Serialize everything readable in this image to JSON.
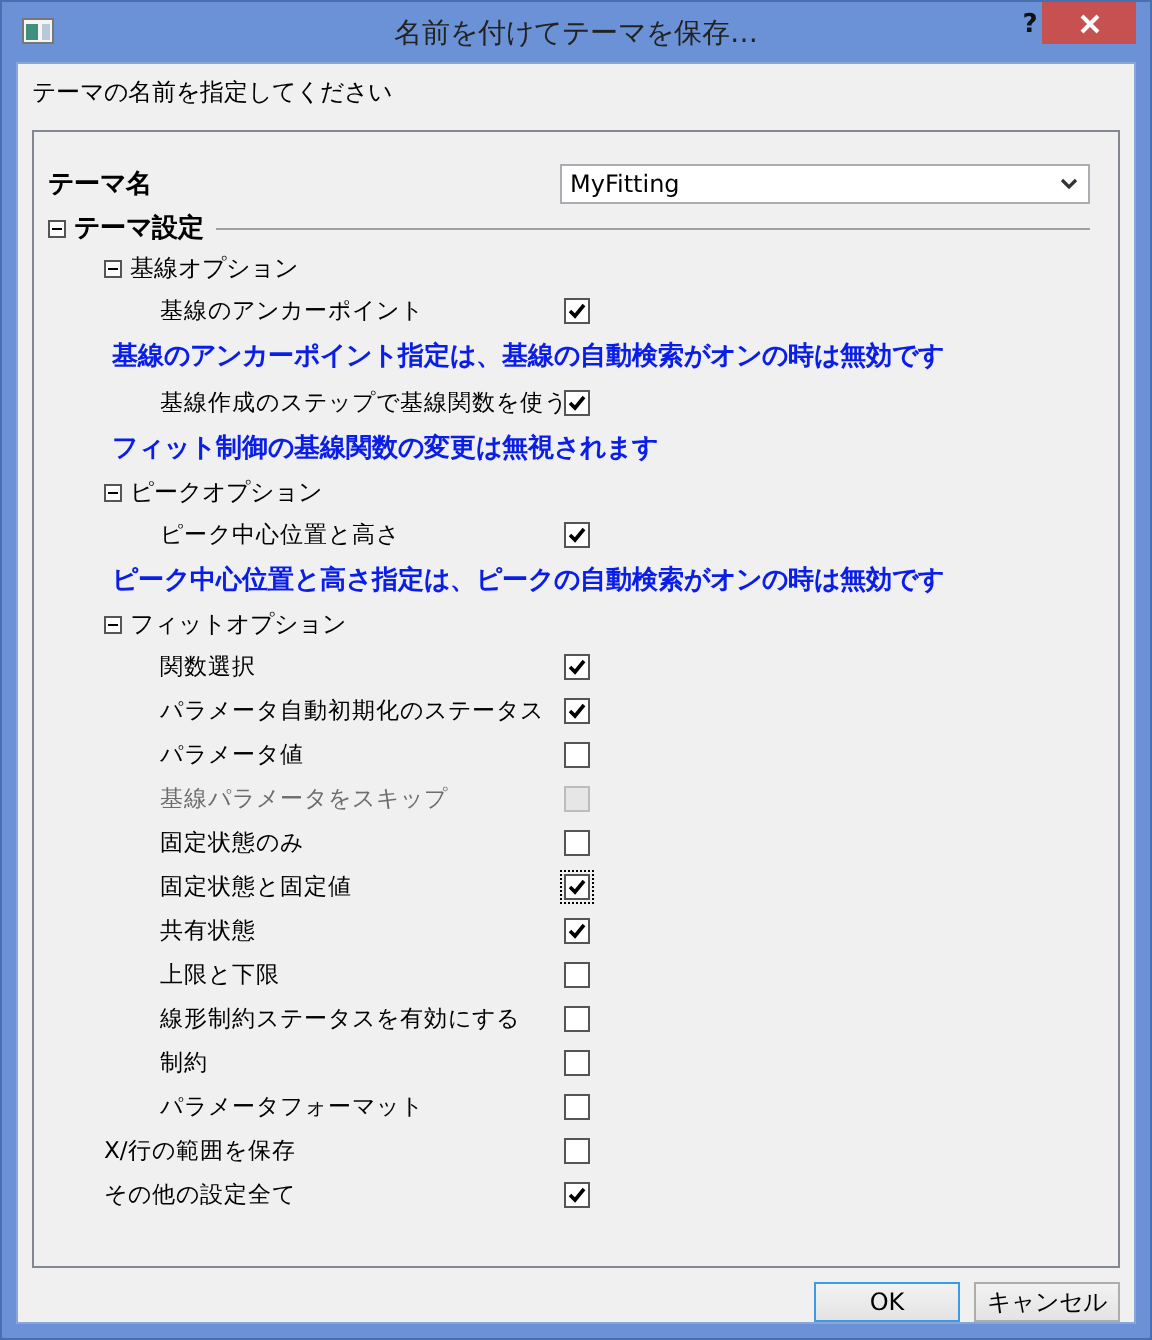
{
  "window": {
    "title": "名前を付けてテーマを保存…",
    "help": "?"
  },
  "prompt": "テーマの名前を指定してください",
  "theme_name": {
    "label": "テーマ名",
    "value": "MyFitting"
  },
  "settings": {
    "label": "テーマ設定",
    "expanded": true,
    "children": [
      {
        "kind": "group",
        "label": "基線オプション",
        "expanded": true,
        "children": [
          {
            "kind": "check",
            "label": "基線のアンカーポイント",
            "checked": true,
            "disabled": false,
            "focused": false
          },
          {
            "kind": "note",
            "text": "基線のアンカーポイント指定は、基線の自動検索がオンの時は無効です"
          },
          {
            "kind": "check",
            "label": "基線作成のステップで基線関数を使う",
            "checked": true,
            "disabled": false,
            "focused": false
          },
          {
            "kind": "note",
            "text": "フィット制御の基線関数の変更は無視されます"
          }
        ]
      },
      {
        "kind": "group",
        "label": "ピークオプション",
        "expanded": true,
        "children": [
          {
            "kind": "check",
            "label": "ピーク中心位置と高さ",
            "checked": true,
            "disabled": false,
            "focused": false
          },
          {
            "kind": "note",
            "text": "ピーク中心位置と高さ指定は、ピークの自動検索がオンの時は無効です"
          }
        ]
      },
      {
        "kind": "group",
        "label": "フィットオプション",
        "expanded": true,
        "children": [
          {
            "kind": "check",
            "label": "関数選択",
            "checked": true,
            "disabled": false,
            "focused": false
          },
          {
            "kind": "check",
            "label": "パラメータ自動初期化のステータス",
            "checked": true,
            "disabled": false,
            "focused": false
          },
          {
            "kind": "check",
            "label": "パラメータ値",
            "checked": false,
            "disabled": false,
            "focused": false
          },
          {
            "kind": "check",
            "label": "基線パラメータをスキップ",
            "checked": false,
            "disabled": true,
            "focused": false
          },
          {
            "kind": "check",
            "label": "固定状態のみ",
            "checked": false,
            "disabled": false,
            "focused": false
          },
          {
            "kind": "check",
            "label": "固定状態と固定値",
            "checked": true,
            "disabled": false,
            "focused": true
          },
          {
            "kind": "check",
            "label": "共有状態",
            "checked": true,
            "disabled": false,
            "focused": false
          },
          {
            "kind": "check",
            "label": "上限と下限",
            "checked": false,
            "disabled": false,
            "focused": false
          },
          {
            "kind": "check",
            "label": "線形制約ステータスを有効にする",
            "checked": false,
            "disabled": false,
            "focused": false
          },
          {
            "kind": "check",
            "label": "制約",
            "checked": false,
            "disabled": false,
            "focused": false
          },
          {
            "kind": "check",
            "label": "パラメータフォーマット",
            "checked": false,
            "disabled": false,
            "focused": false
          }
        ]
      },
      {
        "kind": "check",
        "label": "X/行の範囲を保存",
        "checked": false,
        "disabled": false,
        "focused": false
      },
      {
        "kind": "check",
        "label": "その他の設定全て",
        "checked": true,
        "disabled": false,
        "focused": false
      }
    ]
  },
  "buttons": [
    {
      "label": "OK",
      "default": true
    },
    {
      "label": "キャンセル",
      "default": false
    }
  ]
}
